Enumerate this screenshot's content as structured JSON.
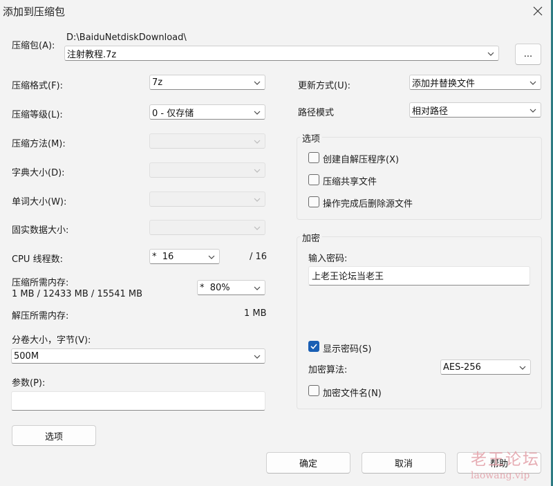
{
  "window": {
    "title": "添加到压缩包"
  },
  "archive": {
    "label": "压缩包(A):",
    "folder": "D:\\BaiduNetdiskDownload\\",
    "name": "注射教程.7z",
    "browse_label": "..."
  },
  "left": {
    "format_label": "压缩格式(F):",
    "format_value": "7z",
    "level_label": "压缩等级(L):",
    "level_value": "0 - 仅存储",
    "method_label": "压缩方法(M):",
    "dict_label": "字典大小(D):",
    "word_label": "单词大小(W):",
    "solid_label": "固实数据大小:",
    "cpu_label": "CPU 线程数:",
    "cpu_value": "*  16",
    "cpu_total": "/ 16",
    "mem_label": "压缩所需内存:",
    "mem_detail": "1 MB / 12433 MB / 15541 MB",
    "mem_value": "*  80%",
    "decomp_label": "解压所需内存:",
    "decomp_value": "1 MB",
    "volume_label": "分卷大小，字节(V):",
    "volume_value": "500M",
    "params_label": "参数(P):",
    "params_value": "",
    "options_button": "选项"
  },
  "right": {
    "update_label": "更新方式(U):",
    "update_value": "添加并替换文件",
    "path_label": "路径模式",
    "path_value": "相对路径",
    "options_group": {
      "title": "选项",
      "sfx_label": "创建自解压程序(X)",
      "shared_label": "压缩共享文件",
      "delete_label": "操作完成后删除源文件",
      "sfx_checked": false,
      "shared_checked": false,
      "delete_checked": false
    },
    "encrypt_group": {
      "title": "加密",
      "password_label": "输入密码:",
      "password_value": "上老王论坛当老王",
      "show_password_label": "显示密码(S)",
      "show_password_checked": true,
      "method_label": "加密算法:",
      "method_value": "AES-256",
      "encrypt_names_label": "加密文件名(N)",
      "encrypt_names_checked": false
    }
  },
  "buttons": {
    "ok": "确定",
    "cancel": "取消",
    "help": "帮助"
  },
  "watermark": {
    "line1": "老王论坛",
    "line2": "laowang.vip"
  },
  "colors": {
    "accent": "#1a5fb4",
    "background": "#f3f3f3",
    "watermark": "#e3a0a8"
  }
}
